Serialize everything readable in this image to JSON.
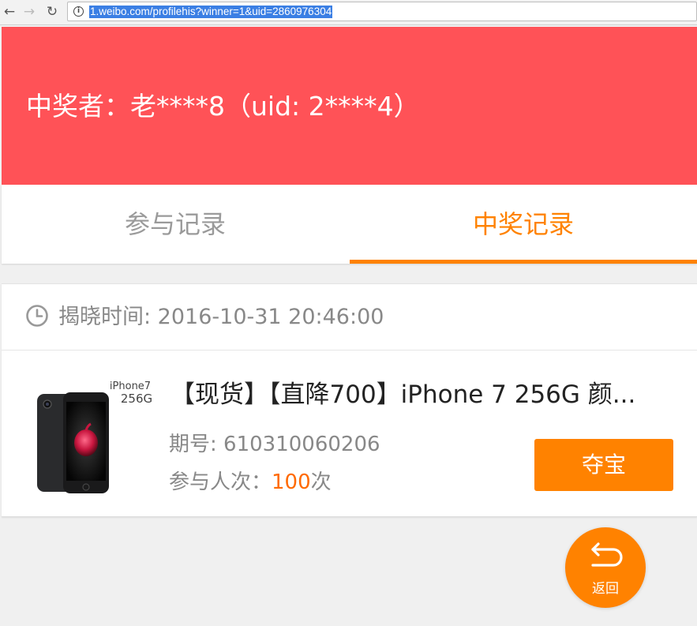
{
  "browser": {
    "back_glyph": "←",
    "forward_glyph": "→",
    "reload_glyph": "↻",
    "info_glyph": "i",
    "url": "1.weibo.com/profilehis?winner=1&uid=2860976304"
  },
  "header": {
    "winner_text": "中奖者：老****8（uid: 2****4）",
    "background_color": "#ff5257"
  },
  "tabs": [
    {
      "label": "参与记录",
      "active": false
    },
    {
      "label": "中奖记录",
      "active": true
    }
  ],
  "record": {
    "reveal_time": "揭晓时间: 2016-10-31 20:46:00",
    "product_title": "【现货】【直降700】iPhone 7 256G 颜...",
    "image_caption_line1": "iPhone7",
    "image_caption_line2": "256G",
    "issue_number": "期号: 610310060206",
    "participants_label": "参与人次：",
    "participants_count": "100",
    "participants_unit": "次",
    "grab_button_label": "夺宝"
  },
  "back_button": {
    "label": "返回",
    "icon": "return-arrow-icon"
  },
  "colors": {
    "accent": "#ff8200",
    "header_red": "#ff5257"
  }
}
